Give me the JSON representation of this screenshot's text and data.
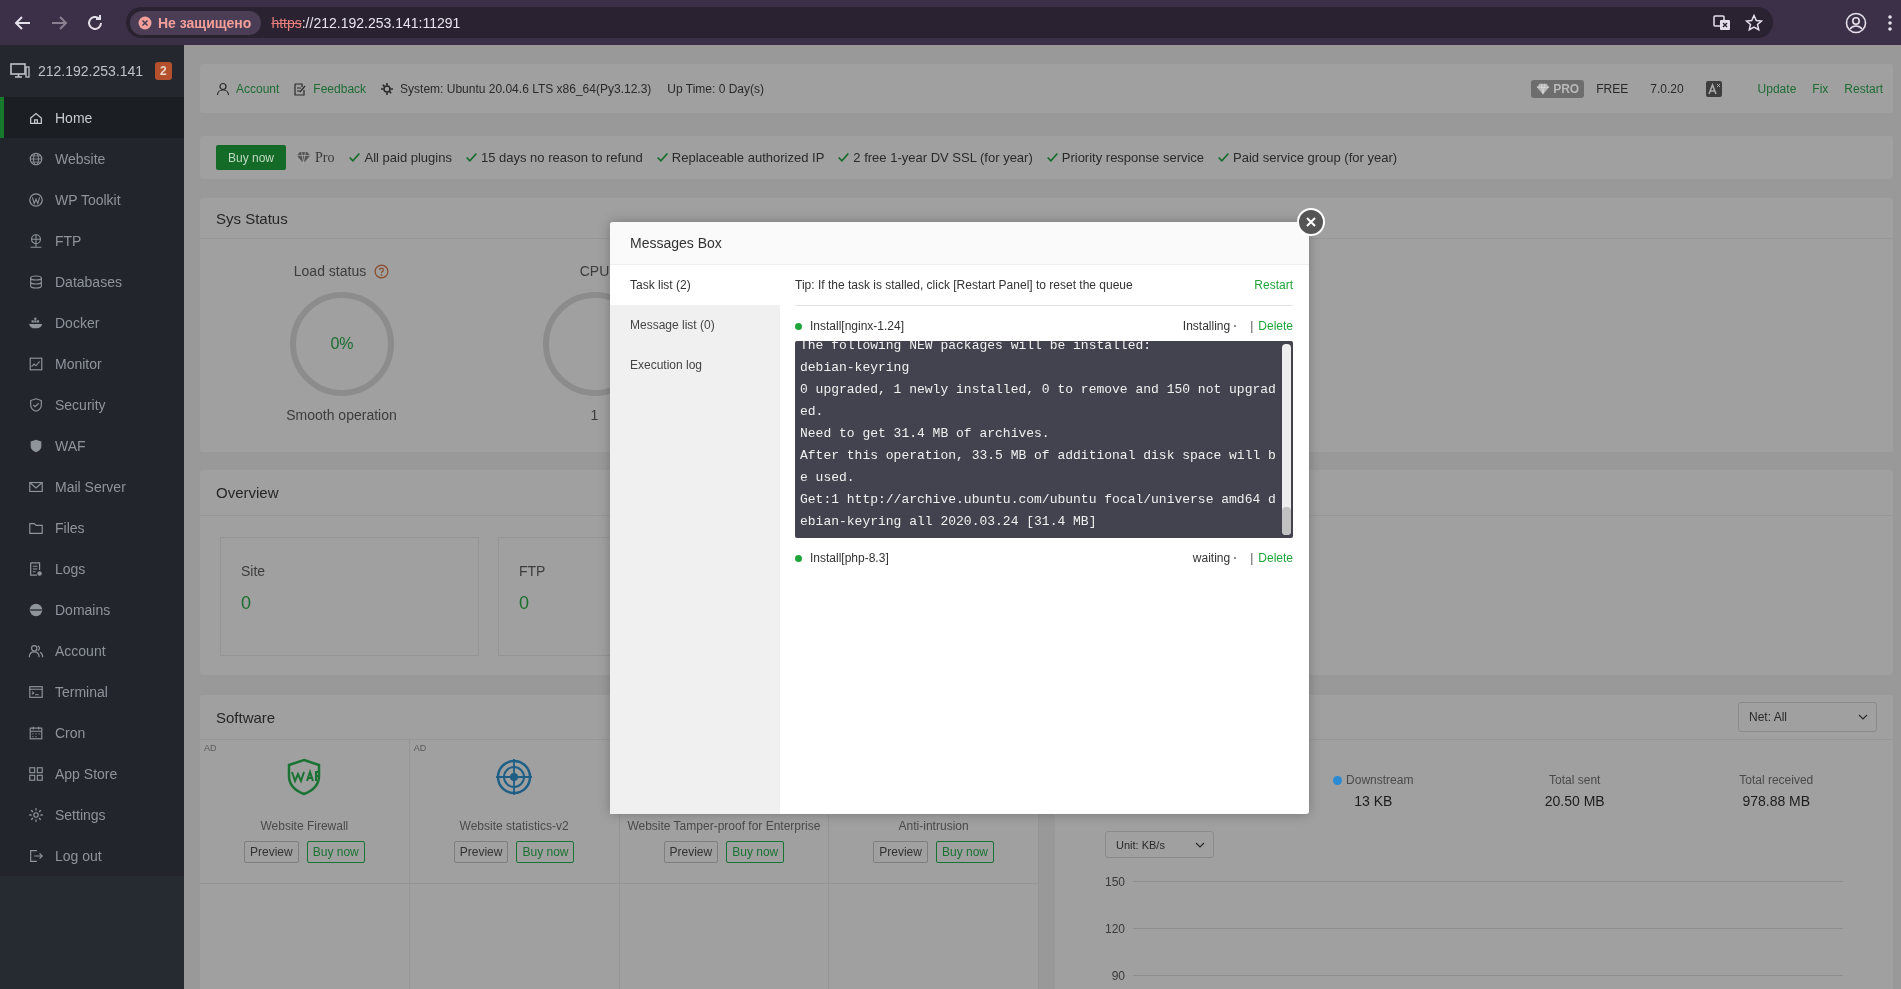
{
  "browser": {
    "forward_disabled": true,
    "security_label": "Не защищено",
    "url_scheme": "https",
    "url_rest": "://212.192.253.141:11291"
  },
  "sidebar": {
    "host": "212.192.253.141",
    "badge": "2",
    "items": [
      {
        "label": "Home",
        "selected": true
      },
      {
        "label": "Website",
        "selected": false
      },
      {
        "label": "WP Toolkit",
        "selected": false
      },
      {
        "label": "FTP",
        "selected": false
      },
      {
        "label": "Databases",
        "selected": false
      },
      {
        "label": "Docker",
        "selected": false
      },
      {
        "label": "Monitor",
        "selected": false
      },
      {
        "label": "Security",
        "selected": false
      },
      {
        "label": "WAF",
        "selected": false
      },
      {
        "label": "Mail Server",
        "selected": false
      },
      {
        "label": "Files",
        "selected": false
      },
      {
        "label": "Logs",
        "selected": false
      },
      {
        "label": "Domains",
        "selected": false
      },
      {
        "label": "Account",
        "selected": false
      },
      {
        "label": "Terminal",
        "selected": false
      },
      {
        "label": "Cron",
        "selected": false
      },
      {
        "label": "App Store",
        "selected": false
      },
      {
        "label": "Settings",
        "selected": false
      },
      {
        "label": "Log out",
        "selected": false
      }
    ]
  },
  "header": {
    "links": [
      "Account",
      "Feedback"
    ],
    "system": "System: Ubuntu 20.04.6 LTS x86_64(Py3.12.3)",
    "uptime": "Up Time: 0 Day(s)",
    "pro_badge": "PRO",
    "edition": "FREE",
    "version": "7.0.20",
    "actions": [
      "Update",
      "Fix",
      "Restart"
    ]
  },
  "promo": {
    "button": "Buy now",
    "tier": "Pro",
    "features": [
      "All paid plugins",
      "15 days no reason to refund",
      "Replaceable authorized IP",
      "2 free 1-year DV SSL (for year)",
      "Priority response service",
      "Paid service group (for year)"
    ]
  },
  "sys_status": {
    "title": "Sys Status",
    "gauges": [
      {
        "label": "Load status",
        "value": "0%",
        "caption": "Smooth operation"
      },
      {
        "label": "CPU",
        "caption": "1"
      }
    ]
  },
  "overview": {
    "title": "Overview",
    "cards": [
      {
        "label": "Site",
        "value": "0"
      },
      {
        "label": "FTP",
        "value": "0"
      }
    ]
  },
  "software": {
    "title": "Software",
    "items": [
      {
        "kind": "waf-shield",
        "ad": "AD",
        "name": "Website Firewall",
        "buttons": [
          "Preview",
          "Buy now"
        ]
      },
      {
        "kind": "target",
        "ad": "AD",
        "name": "Website statistics-v2",
        "buttons": [
          "Preview",
          "Buy now"
        ]
      },
      {
        "name": "Website Tamper-proof for Enterprise",
        "buttons": [
          "Preview",
          "Buy now"
        ]
      },
      {
        "name": "Anti-intrusion",
        "buttons": [
          "Preview",
          "Buy now"
        ]
      }
    ]
  },
  "network": {
    "selector": "Net: All",
    "stats": [
      {
        "label": "Downstream",
        "value": "13 KB",
        "color": "#2a8ad4"
      },
      {
        "label": "Total sent",
        "value": "20.50 MB"
      },
      {
        "label": "Total received",
        "value": "978.88 MB"
      }
    ],
    "unit_selector": "Unit: KB/s",
    "y_ticks": [
      "150",
      "120",
      "90"
    ]
  },
  "messages_box": {
    "title": "Messages Box",
    "tabs": [
      {
        "label": "Task list (2)",
        "selected": true
      },
      {
        "label": "Message list (0)",
        "selected": false
      },
      {
        "label": "Execution log",
        "selected": false
      }
    ],
    "tip": "Tip: If the task is stalled, click [Restart Panel] to reset the queue",
    "restart": "Restart",
    "tasks": [
      {
        "name": "Install[nginx-1.24]",
        "status": "Installing",
        "separator": "|",
        "action": "Delete",
        "log": [
          "The following NEW packages will be installed:",
          "debian-keyring",
          "0 upgraded, 1 newly installed, 0 to remove and 150 not upgraded.",
          "Need to get 31.4 MB of archives.",
          "After this operation, 33.5 MB of additional disk space will be used.",
          "Get:1 http://archive.ubuntu.com/ubuntu focal/universe amd64 debian-keyring all 2020.03.24 [31.4 MB]"
        ]
      },
      {
        "name": "Install[php-8.3]",
        "status": "waiting",
        "separator": "|",
        "action": "Delete"
      }
    ]
  }
}
